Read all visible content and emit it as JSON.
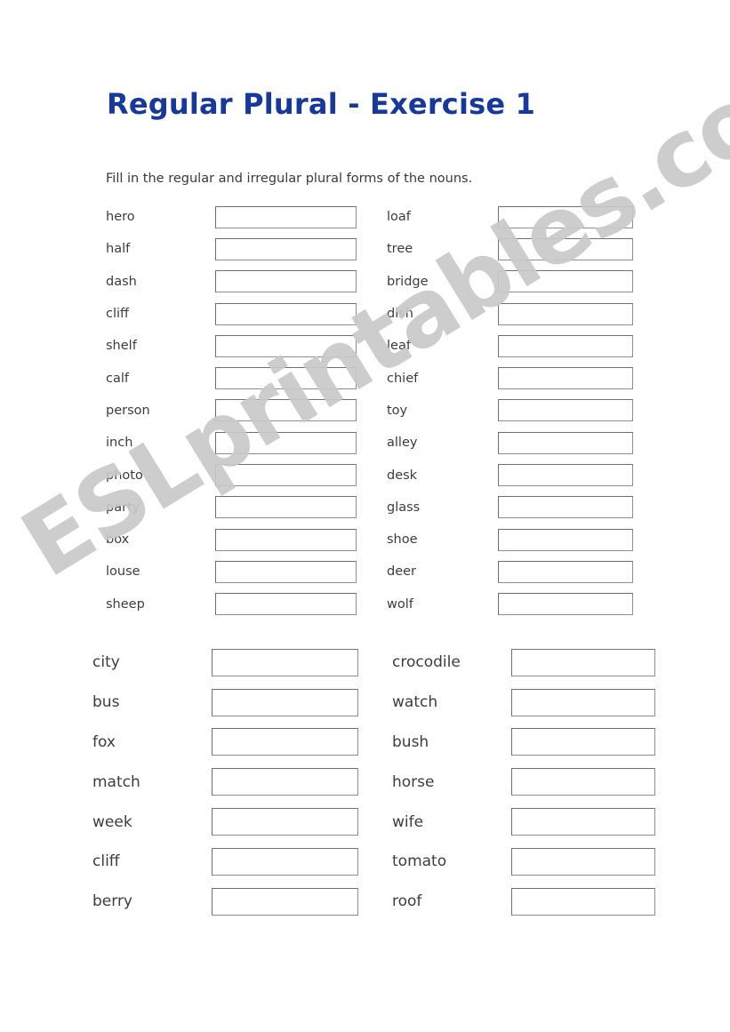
{
  "page": {
    "title": "Regular Plural - Exercise 1",
    "instruction": "Fill in the regular and irregular plural forms of the nouns.",
    "title_color": "#17389c",
    "text_color": "#3d3d3d",
    "background_color": "#ffffff",
    "box_border_color": "#8e8e8e"
  },
  "watermark": {
    "text": "ESLprintables.com",
    "color": "#c9c9c9",
    "rotation_deg": -31.5
  },
  "exercise_top": {
    "left_column": [
      {
        "word": "hero",
        "answer": ""
      },
      {
        "word": "half",
        "answer": ""
      },
      {
        "word": "dash",
        "answer": ""
      },
      {
        "word": "cliff",
        "answer": ""
      },
      {
        "word": "shelf",
        "answer": ""
      },
      {
        "word": "calf",
        "answer": ""
      },
      {
        "word": "person",
        "answer": ""
      },
      {
        "word": "inch",
        "answer": ""
      },
      {
        "word": "photo",
        "answer": ""
      },
      {
        "word": "party",
        "answer": ""
      },
      {
        "word": "box",
        "answer": ""
      },
      {
        "word": "louse",
        "answer": ""
      },
      {
        "word": "sheep",
        "answer": ""
      }
    ],
    "right_column": [
      {
        "word": "loaf",
        "answer": ""
      },
      {
        "word": "tree",
        "answer": ""
      },
      {
        "word": "bridge",
        "answer": ""
      },
      {
        "word": "dish",
        "answer": ""
      },
      {
        "word": "leaf",
        "answer": ""
      },
      {
        "word": "chief",
        "answer": ""
      },
      {
        "word": "toy",
        "answer": ""
      },
      {
        "word": "alley",
        "answer": ""
      },
      {
        "word": "desk",
        "answer": ""
      },
      {
        "word": "glass",
        "answer": ""
      },
      {
        "word": "shoe",
        "answer": ""
      },
      {
        "word": "deer",
        "answer": ""
      },
      {
        "word": "wolf",
        "answer": ""
      }
    ]
  },
  "exercise_bottom": {
    "left_column": [
      {
        "word": "city",
        "answer": ""
      },
      {
        "word": "bus",
        "answer": ""
      },
      {
        "word": "fox",
        "answer": ""
      },
      {
        "word": "match",
        "answer": ""
      },
      {
        "word": "week",
        "answer": ""
      },
      {
        "word": "cliff",
        "answer": ""
      },
      {
        "word": "berry",
        "answer": ""
      }
    ],
    "right_column": [
      {
        "word": "crocodile",
        "answer": ""
      },
      {
        "word": "watch",
        "answer": ""
      },
      {
        "word": "bush",
        "answer": ""
      },
      {
        "word": "horse",
        "answer": ""
      },
      {
        "word": "wife",
        "answer": ""
      },
      {
        "word": "tomato",
        "answer": ""
      },
      {
        "word": "roof",
        "answer": ""
      }
    ]
  }
}
